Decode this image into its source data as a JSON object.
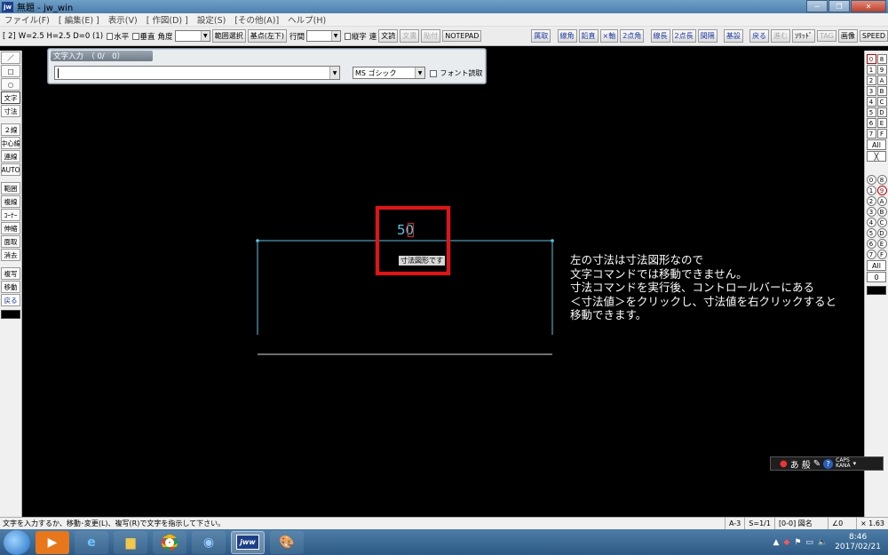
{
  "window": {
    "title": "無題 - jw_win",
    "app_icon": "jw"
  },
  "menu": [
    "ファイル(F)",
    "[ 編集(E) ]",
    "表示(V)",
    "[ 作図(D) ]",
    "設定(S)",
    "[その他(A)]",
    "ヘルプ(H)"
  ],
  "control_bar": {
    "mode": "[ 2]",
    "size": "W=2.5 H=2.5 D=0 (1)",
    "horizontal": "水平",
    "vertical": "垂直",
    "angle": "角度",
    "range_select": "範囲選択",
    "base_point": "基点(左下)",
    "line_spacing": "行間",
    "vertical_text": "縦字",
    "ren": "連",
    "text_style": "文読",
    "text_write": "文書",
    "paste": "貼付",
    "notepad": "NOTEPAD"
  },
  "right_buttons": [
    "属取",
    "線角",
    "鉛直",
    "×軸",
    "2点角",
    "線長",
    "2点長",
    "間隔",
    "基設",
    "戻る",
    "進む",
    "ｿﾘｯﾄﾞ",
    "TAG",
    "画像",
    "SPEED"
  ],
  "left_tools": [
    "／",
    "□",
    "○",
    "文字",
    "寸法",
    "２線",
    "中心線",
    "連線",
    "AUTO",
    "範囲",
    "複線",
    "ｺｰﾅｰ",
    "伸縮",
    "面取",
    "消去",
    "複写",
    "移動",
    "戻る"
  ],
  "right_layers_top": [
    [
      "0",
      "8"
    ],
    [
      "1",
      "9"
    ],
    [
      "2",
      "A"
    ],
    [
      "3",
      "B"
    ],
    [
      "4",
      "C"
    ],
    [
      "5",
      "D"
    ],
    [
      "6",
      "E"
    ],
    [
      "7",
      "F"
    ]
  ],
  "right_layers_top_all": "All",
  "right_layers_top_x": "╳",
  "right_layers_bottom": [
    [
      "0",
      "8"
    ],
    [
      "1",
      "9"
    ],
    [
      "2",
      "A"
    ],
    [
      "3",
      "B"
    ],
    [
      "4",
      "C"
    ],
    [
      "5",
      "D"
    ],
    [
      "6",
      "E"
    ],
    [
      "7",
      "F"
    ]
  ],
  "right_layers_bottom_all": "All",
  "right_layers_bottom_zero": "0",
  "text_dialog": {
    "title": "文字入力　（ 0/　0）",
    "input_value": "",
    "font": "MS ゴシック",
    "font_read": "フォント読取"
  },
  "drawing": {
    "dimension_value": "50",
    "tooltip": "寸法図形です",
    "colors": {
      "dimension": "#4ec9e6",
      "baseline": "#dddddd",
      "highlight": "#e81010"
    }
  },
  "annotation": [
    "左の寸法は寸法図形なので",
    "文字コマンドでは移動できません。",
    "寸法コマンドを実行後、コントロールバーにある",
    "＜寸法値＞をクリックし、寸法値を右クリックすると",
    "移動できます。"
  ],
  "ime": {
    "mode": "あ",
    "label": "般"
  },
  "status_bar": {
    "message": "文字を入力するか、移動･変更(L)、複写(R)で文字を指示して下さい。",
    "paper": "A-3",
    "scale": "S=1/1",
    "layer": "[0-0] 図名",
    "angle": "∠0",
    "zoom": "× 1.63"
  },
  "taskbar": {
    "icons": [
      "windows-start",
      "media-player",
      "internet-explorer",
      "file-explorer",
      "chrome",
      "browser",
      "jw-cad",
      "paint"
    ],
    "jw_label": "jww",
    "time": "8:46",
    "date": "2017/02/21"
  }
}
